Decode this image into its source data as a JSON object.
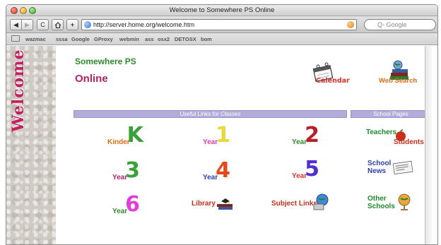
{
  "window": {
    "title": "Welcome to Somewhere PS Online"
  },
  "toolbar": {
    "back_icon": "back-arrow-icon",
    "forward_icon": "forward-arrow-icon",
    "reload_label": "C",
    "home_icon": "home-icon",
    "add_label": "+",
    "address": "http://server.home.org/welcome.htm",
    "search_placeholder": "Q- Google"
  },
  "bookmarks": [
    "wazmac",
    "sssa",
    "Google",
    "GProxy",
    "webmin",
    "ass",
    "osx2",
    "DETOSX",
    "bom"
  ],
  "page": {
    "sidebar_text": "Welcome",
    "school_name": "Somewhere PS",
    "online": "Online",
    "calendar_label": "Calendar",
    "web_search_label": "Web Search",
    "links_bar": "Useful Links for ",
    "links_bar_em": "Classes",
    "school_bar": "School Pages",
    "classes": [
      {
        "label": "Kinder",
        "mark": "K",
        "color": "#3aa03a"
      },
      {
        "label": "Year",
        "mark": "1",
        "color": "#e8d93a"
      },
      {
        "label": "Year",
        "mark": "2",
        "color": "#b8202a"
      },
      {
        "label": "Year",
        "mark": "3",
        "color": "#3aa03a"
      },
      {
        "label": "Year",
        "mark": "4",
        "color": "#e04b1c"
      },
      {
        "label": "Year",
        "mark": "5",
        "color": "#4f2fd0"
      },
      {
        "label": "Year",
        "mark": "6",
        "color": "#e03fd8"
      },
      {
        "label": "Library"
      },
      {
        "label": "Subject Links"
      }
    ],
    "school_pages": {
      "teachers": "Teachers",
      "students": "Students",
      "school": "School",
      "news": "News",
      "other": "Other",
      "schools": "Schools"
    }
  }
}
